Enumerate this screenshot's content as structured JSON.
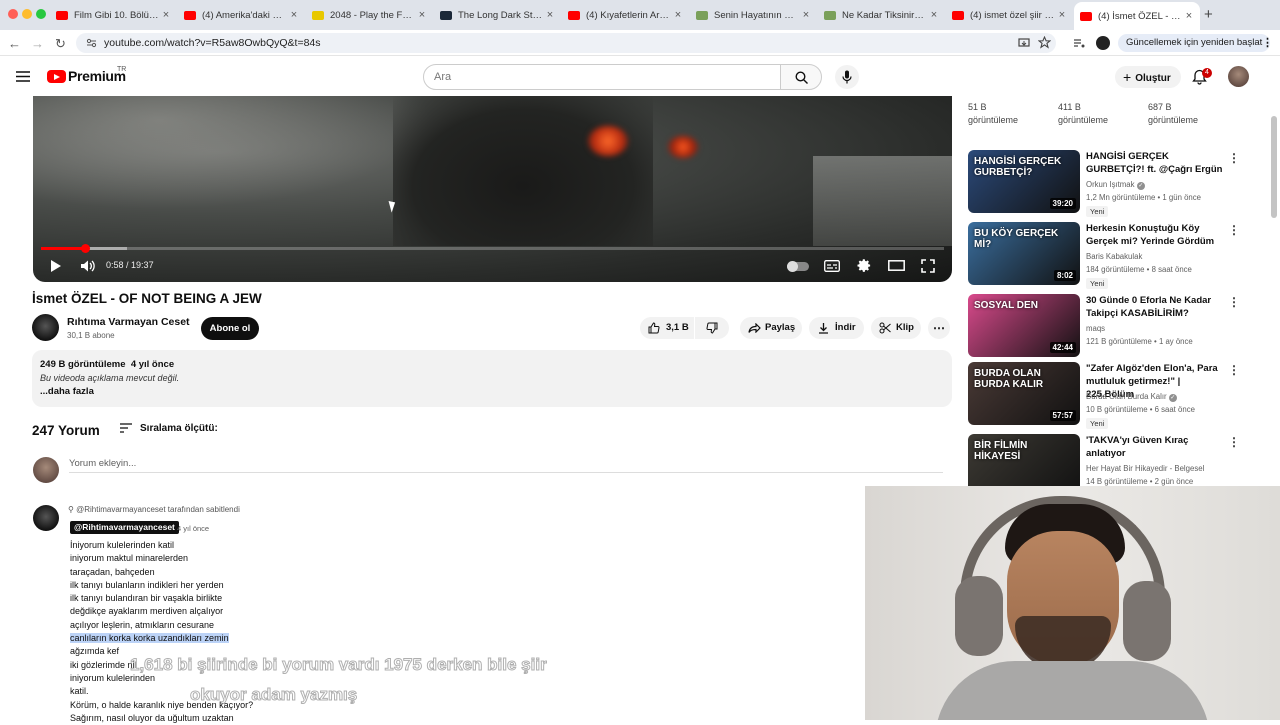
{
  "browser": {
    "tabs": [
      {
        "title": "Film Gibi 10. Bölüm -",
        "favicon_color": "#ff0000"
      },
      {
        "title": "(4) Amerika'daki Her",
        "favicon_color": "#ff0000"
      },
      {
        "title": "2048 - Play the Free",
        "favicon_color": "#e8c800"
      },
      {
        "title": "The Long Dark Steam",
        "favicon_color": "#1b2838"
      },
      {
        "title": "(4) Kıyafetlerin Arası",
        "favicon_color": "#ff0000"
      },
      {
        "title": "Senin Hayatının En Z",
        "favicon_color": "#7aa05a"
      },
      {
        "title": "Ne Kadar Tiksinirsin?",
        "favicon_color": "#7aa05a"
      },
      {
        "title": "(4) ismet özel şiir - Y",
        "favicon_color": "#ff0000"
      },
      {
        "title": "(4) İsmet ÖZEL - OF",
        "favicon_color": "#ff0000",
        "active": true
      }
    ],
    "url": "youtube.com/watch?v=R5aw8OwbQyQ&t=84s",
    "update_button": "Güncellemek için yeniden başlat"
  },
  "header": {
    "logo": "Premium",
    "region": "TR",
    "search_placeholder": "Ara",
    "create_label": "Oluştur",
    "notification_count": "4"
  },
  "player": {
    "current_time": "0:58",
    "duration": "19:37",
    "progress": 0.049
  },
  "video": {
    "title": "İsmet ÖZEL - OF NOT BEING A JEW",
    "channel": "Rıhtıma Varmayan Ceset",
    "subscribers": "30,1 B abone",
    "subscribe_label": "Abone ol",
    "likes": "3,1 B",
    "share_label": "Paylaş",
    "download_label": "İndir",
    "clip_label": "Klip"
  },
  "description": {
    "views": "249 B görüntüleme",
    "age": "4 yıl önce",
    "text": "Bu videoda açıklama mevcut değil.",
    "more": "...daha fazla"
  },
  "comments": {
    "count": "247 Yorum",
    "sort_label": "Sıralama ölçütü:",
    "add_placeholder": "Yorum ekleyin...",
    "pinned_note": "@Rihtimavarmayanceset tarafından sabitlendi",
    "pinned": {
      "author": "@Rihtimavarmayanceset",
      "time": "4 yıl önce",
      "lines": [
        "İniyorum kulelerinden katil",
        "iniyorum maktul minarelerden",
        "taraçadan, bahçeden",
        "ilk tanıyı bulanların indikleri her yerden",
        "ilk tanıyı bulandıran bir vaşakla birlikte",
        "değdikçe ayaklarım merdiven alçalıyor",
        "açılıyor leşlerin, atmıkların cesurane",
        "canlıların korka korka uzandıkları zemin",
        "ağzımda kef",
        "iki gözlerimde nil",
        "iniyorum kulelerinden",
        "katil.",
        "Körüm, o halde karanlık niye benden kaçıyor?",
        "Sağırım, nasıl oluyor da uğultum uzaktan"
      ],
      "highlighted_line": 7
    }
  },
  "overlay": {
    "line1": "1,618  bi şiirinde bi yorum vardı 1975 derken bile şiir",
    "line2": "okuyor adam yazmış"
  },
  "sidebar": {
    "top_stats": [
      {
        "count": "51 B",
        "label": "görüntüleme"
      },
      {
        "count": "411 B",
        "label": "görüntüleme"
      },
      {
        "count": "687 B",
        "label": "görüntüleme"
      }
    ],
    "recommendations": [
      {
        "title": "HANGİSİ GERÇEK GURBETÇİ?! ft. @Çağrı Ergün",
        "channel": "Orkun Işıtmak",
        "verified": true,
        "meta": "1,2 Mn görüntüleme • 1 gün önce",
        "badge": "Yeni",
        "duration": "39:20",
        "thumb_text": "HANGİSİ GERÇEK GURBETÇİ?",
        "thumb_color": "#2b4a7a"
      },
      {
        "title": "Herkesin Konuştuğu Köy Gerçek mi? Yerinde Gördüm",
        "channel": "Baris Kabakulak",
        "verified": false,
        "meta": "184 görüntüleme • 8 saat önce",
        "badge": "Yeni",
        "duration": "8:02",
        "thumb_text": "BU KÖY GERÇEK Mİ?",
        "thumb_color": "#3a6e9e"
      },
      {
        "title": "30 Günde 0 Eforla Ne Kadar Takipçi KASABİLİRİM?",
        "channel": "maqs",
        "verified": false,
        "meta": "121 B görüntüleme • 1 ay önce",
        "badge": "",
        "duration": "42:44",
        "thumb_text": "SOSYAL DEN",
        "thumb_color": "#d94a8c"
      },
      {
        "title": "\"Zafer Algöz'den Elon'a, Para mutluluk getirmez!\" | 225.Bölüm",
        "channel": "Burda Olan Burda Kalır",
        "verified": true,
        "meta": "10 B görüntüleme • 6 saat önce",
        "badge": "Yeni",
        "duration": "57:57",
        "thumb_text": "BURDA OLAN BURDA KALIR",
        "thumb_color": "#4a3a36"
      },
      {
        "title": "'TAKVA'yı Güven Kıraç anlatıyor",
        "channel": "Her Hayat Bir Hikayedir - Belgesel",
        "verified": false,
        "meta": "14 B görüntüleme • 2 gün önce",
        "badge": "Yeni",
        "duration": "",
        "thumb_text": "BİR FİLMİN HİKAYESİ",
        "thumb_color": "#3d3a34"
      }
    ]
  }
}
